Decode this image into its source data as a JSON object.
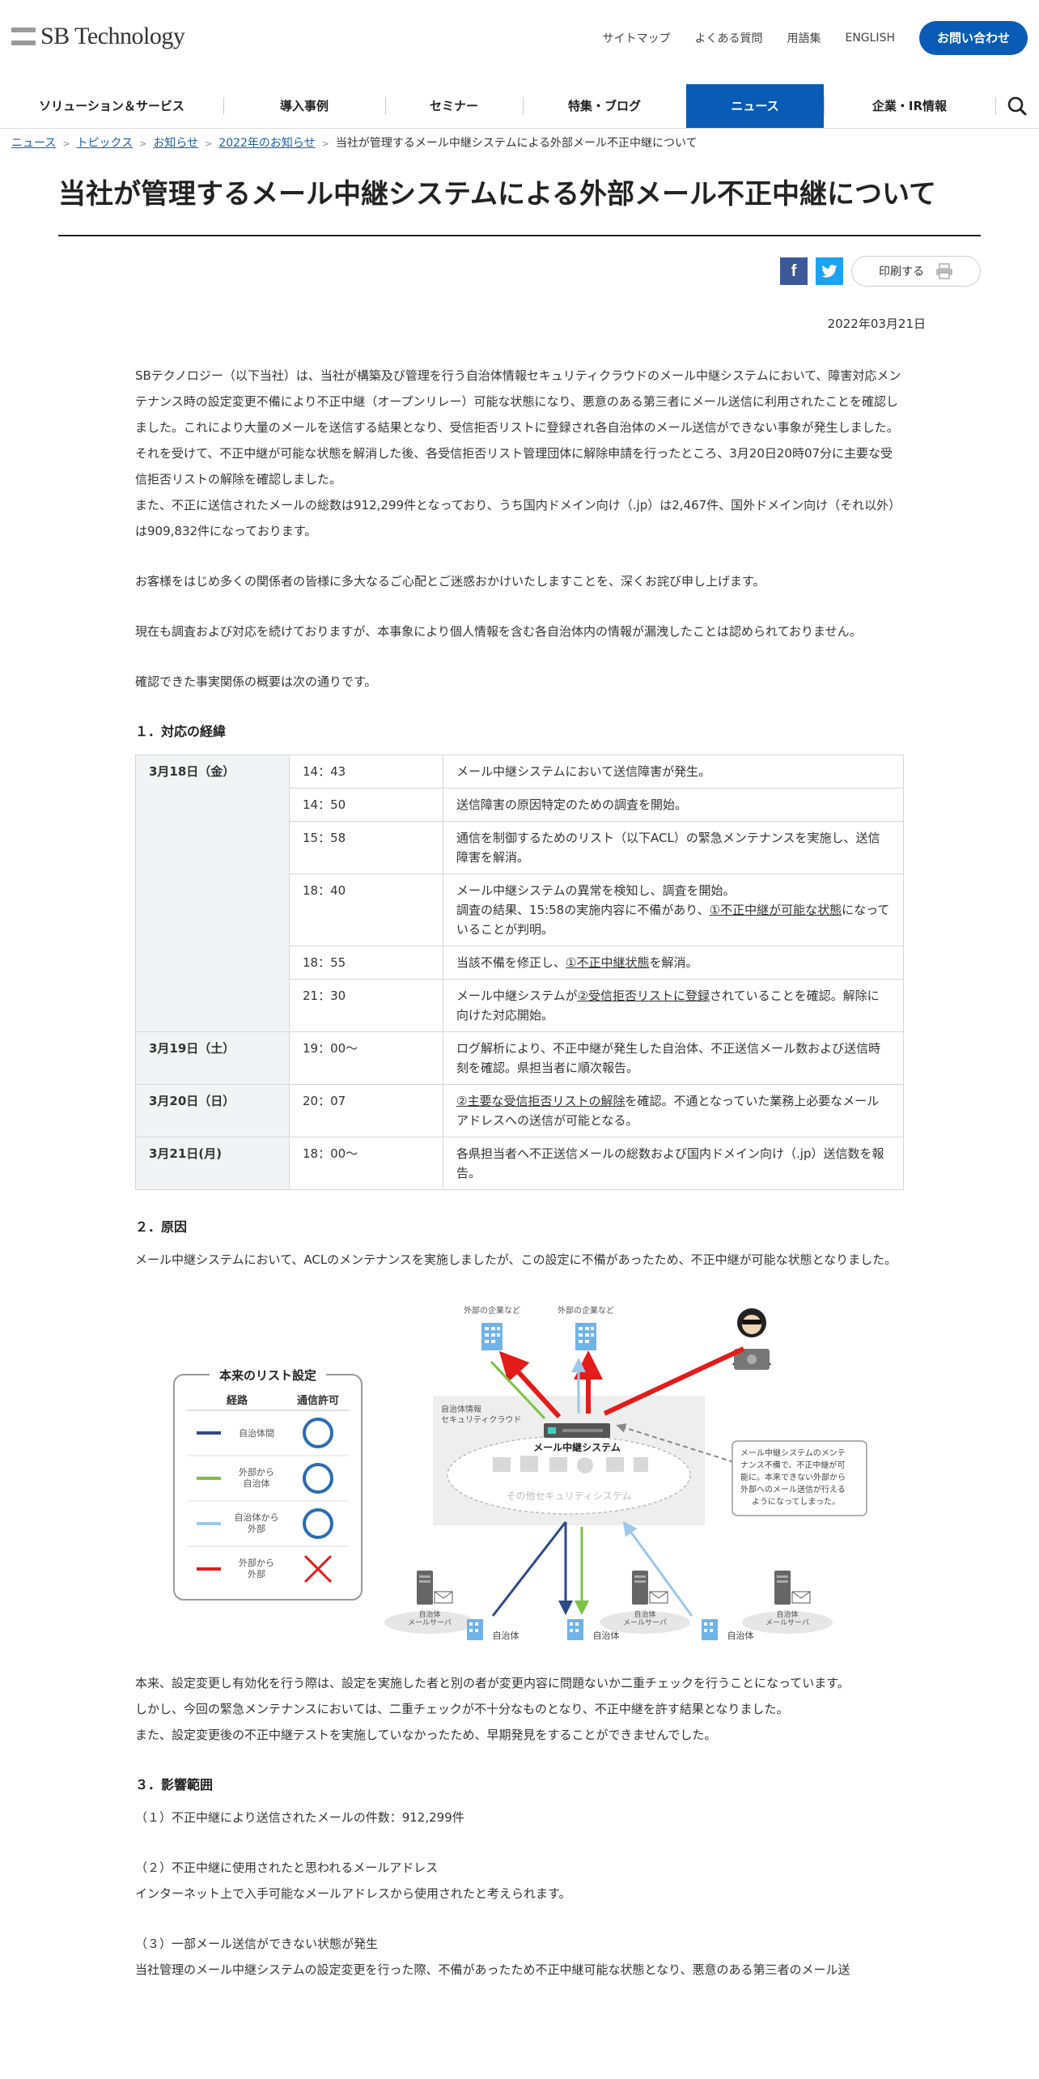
{
  "brand": {
    "name": "SB Technology",
    "accent": "#0a5bb5"
  },
  "util_nav": {
    "links": [
      "サイトマップ",
      "よくある質問",
      "用語集",
      "ENGLISH"
    ],
    "contact": "お問い合わせ"
  },
  "global_nav": {
    "items": [
      "ソリューション＆サービス",
      "導入事例",
      "セミナー",
      "特集・ブログ",
      "ニュース",
      "企業・IR情報"
    ],
    "active": "ニュース",
    "search_icon": "search-icon"
  },
  "breadcrumb": {
    "links": [
      "ニュース",
      "トピックス",
      "お知らせ",
      "2022年のお知らせ"
    ],
    "current": "当社が管理するメール中継システムによる外部メール不正中継について"
  },
  "article": {
    "title": "当社が管理するメール中継システムによる外部メール不正中継について",
    "print_label": "印刷する",
    "date": "2022年03月21日",
    "intro_p1": "SBテクノロジー（以下当社）は、当社が構築及び管理を行う自治体情報セキュリティクラウドのメール中継システムにおいて、障害対応メンテナンス時の設定変更不備により不正中継（オープンリレー）可能な状態になり、悪意のある第三者にメール送信に利用されたことを確認しました。これにより大量のメールを送信する結果となり、受信拒否リストに登録され各自治体のメール送信ができない事象が発生しました。それを受けて、不正中継が可能な状態を解消した後、各受信拒否リスト管理団体に解除申請を行ったところ、3月20日20時07分に主要な受信拒否リストの解除を確認しました。",
    "intro_p2": "また、不正に送信されたメールの総数は912,299件となっており、うち国内ドメイン向け（.jp）は2,467件、国外ドメイン向け（それ以外）は909,832件になっております。",
    "apology": "お客様をはじめ多くの関係者の皆様に多大なるご心配とご迷惑おかけいたしますことを、深くお詫び申し上げます。",
    "investigation": "現在も調査および対応を続けておりますが、本事象により個人情報を含む各自治体内の情報が漏洩したことは認められておりません。",
    "facts_intro": "確認できた事実関係の概要は次の通りです。",
    "sec1_title": "１．対応の経緯",
    "timeline": {
      "d1": "3月18日（金）",
      "d2": "3月19日（土）",
      "d3": "3月20日（日）",
      "d4": "3月21日(月)",
      "r1_time": "14：43",
      "r1_text": "メール中継システムにおいて送信障害が発生。",
      "r2_time": "14：50",
      "r2_text": "送信障害の原因特定のための調査を開始。",
      "r3_time": "15：58",
      "r3_text": "通信を制御するためのリスト（以下ACL）の緊急メンテナンスを実施し、送信障害を解消。",
      "r4_time": "18：40",
      "r4_text_a": "メール中継システムの異常を検知し、調査を開始。",
      "r4_text_b": "調査の結果、15:58の実施内容に不備があり、",
      "r4_link": "①不正中継が可能な状態",
      "r4_text_c": "になっていることが判明。",
      "r5_time": "18：55",
      "r5_text_a": "当該不備を修正し、",
      "r5_link": "①不正中継状態",
      "r5_text_b": "を解消。",
      "r6_time": "21：30",
      "r6_text_a": "メール中継システムが",
      "r6_link": "②受信拒否リストに登録",
      "r6_text_b": "されていることを確認。解除に向けた対応開始。",
      "r7_time": "19：00～",
      "r7_text": "ログ解析により、不正中継が発生した自治体、不正送信メール数および送信時刻を確認。県担当者に順次報告。",
      "r8_time": "20：07",
      "r8_link": "②主要な受信拒否リストの解除",
      "r8_text": "を確認。不通となっていた業務上必要なメールアドレスへの送信が可能となる。",
      "r9_time": "18：00～",
      "r9_text": "各県担当者へ不正送信メールの総数および国内ドメイン向け（.jp）送信数を報告。"
    },
    "sec2_title": "２．原因",
    "cause": "メール中継システムにおいて、ACLのメンテナンスを実施しましたが、この設定に不備があったため、不正中継が可能な状態となりました。",
    "diagram": {
      "external1": "外部の企業など",
      "external2": "外部の企業など",
      "legend_title": "本来のリスト設定",
      "legend_col1": "経路",
      "legend_col2": "通信許可",
      "legend_r1": "自治体間",
      "legend_r2a": "外部から",
      "legend_r2b": "自治体",
      "legend_r3a": "自治体から",
      "legend_r3b": "外部",
      "legend_r4a": "外部から",
      "legend_r4b": "外部",
      "cloud_label_a": "自治体情報",
      "cloud_label_b": "セキュリティクラウド",
      "relay_label": "メール中継システム",
      "other_security": "その他セキュリティシステム",
      "callout_1": "メール中継システムのメンテ",
      "callout_2": "ナンス不備で、不正中継が可",
      "callout_3": "能に。本来できない外部から",
      "callout_4": "外部へのメール送信が行える",
      "callout_5": "ようになってしまった。",
      "muni": "自治体",
      "muni_server": "自治体",
      "mail_server": "メールサーバ",
      "color_red": "#e31b1b",
      "color_navy": "#2c4a86",
      "color_green": "#7cc242",
      "color_lightblue": "#9cc8ea"
    },
    "post_1": "本来、設定変更し有効化を行う際は、設定を実施した者と別の者が変更内容に問題ないか二重チェックを行うことになっています。",
    "post_2": "しかし、今回の緊急メンテナンスにおいては、二重チェックが不十分なものとなり、不正中継を許す結果となりました。",
    "post_3": "また、設定変更後の不正中継テストを実施していなかったため、早期発見をすることができませんでした。",
    "sec3_title": "３．影響範囲",
    "impact_1": "（１）不正中継により送信されたメールの件数：912,299件",
    "impact_2": "（２）不正中継に使用されたと思われるメールアドレス",
    "impact_2b": "インターネット上で入手可能なメールアドレスから使用されたと考えられます。",
    "impact_3": "（３）一部メール送信ができない状態が発生",
    "impact_3b": "当社管理のメール中継システムの設定変更を行った際、不備があったため不正中継可能な状態となり、悪意のある第三者のメール送"
  }
}
